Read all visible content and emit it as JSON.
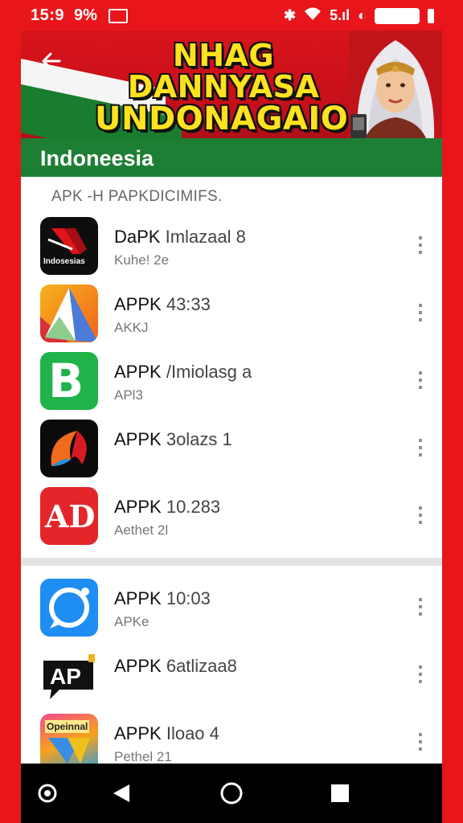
{
  "status_bar": {
    "time": "15:9",
    "battery_pct": "9%",
    "right_text": "5.ıl"
  },
  "banner": {
    "line1": "NHAG DANNYASA",
    "line2": "UNDONAGAIO!"
  },
  "section": {
    "title": "Indoneesia",
    "subheader": "APK -H PAPKDICIMIFS."
  },
  "apps": [
    {
      "title": "DaPK",
      "suffix": "Imlazaal 8",
      "subtitle": "Kuhe! 2e",
      "icon": "red-play-logo-icon",
      "icon_text": "Indosesias"
    },
    {
      "title": "APPK",
      "suffix": "43:33",
      "subtitle": "AKKJ",
      "icon": "orange-triangle-logo-icon"
    },
    {
      "title": "APPK",
      "suffix": "/Imiolasg a",
      "subtitle": "APl3",
      "icon": "green-b-logo-icon",
      "icon_text": "B"
    },
    {
      "title": "APPK",
      "suffix": "3olazs 1",
      "subtitle": "",
      "icon": "swirl-logo-icon"
    },
    {
      "title": "APPK",
      "suffix": "10.283",
      "subtitle": "Aethet 2l",
      "icon": "red-ad-logo-icon",
      "icon_text": "AD"
    },
    {
      "title": "APPK",
      "suffix": "10:03",
      "subtitle": "APKe",
      "icon": "blue-chat-logo-icon"
    },
    {
      "title": "APPK",
      "suffix": "6atlizaa8",
      "subtitle": "",
      "icon": "ap-bubble-logo-icon",
      "icon_text": "AP"
    },
    {
      "title": "APPK",
      "suffix": "Iloao 4",
      "subtitle": "Pethel 21",
      "icon": "colorful-logo-icon",
      "icon_text": "Opeinnal"
    }
  ],
  "colors": {
    "frame_red": "#e8161b",
    "header_green": "#1e7f34",
    "headline_yellow": "#ffe21f"
  }
}
